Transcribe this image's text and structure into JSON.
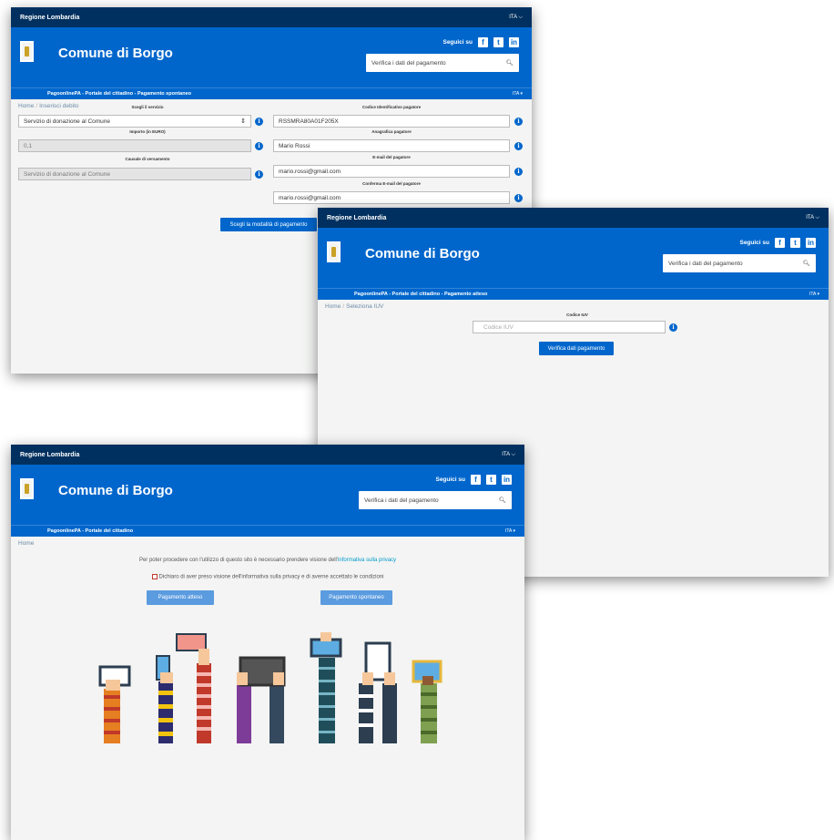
{
  "shared": {
    "region": "Regione Lombardia",
    "lang": "ITA",
    "comune": "Comune di Borgo",
    "follow": "Seguici su",
    "search_placeholder": "Verifica i dati del pagamento",
    "lang_small": "ITA",
    "home": "Home",
    "social": [
      "f",
      "t",
      "in"
    ]
  },
  "window1": {
    "nav": "PagoonlinePA - Portale del cittadino - Pagamento spontaneo",
    "crumb": "Inserisci debito",
    "service_label": "Scegli il servizio",
    "service_value": "Servizio di donazione al Comune",
    "amount_label": "Importo (in EURO)",
    "amount_value": "0,1",
    "causale_label": "Causale di versamento",
    "causale_value": "Servizio di donazione al Comune",
    "cf_label": "Codice Identificativo pagatore",
    "cf_value": "RSSMRA80A01F205X",
    "anag_label": "Anagrafica pagatore",
    "anag_value": "Mario Rossi",
    "email_label": "E-mail del pagatore",
    "email_value": "mario.rossi@gmail.com",
    "email_confirm_label": "Conferma E-mail del pagatore",
    "email_confirm_value": "mario.rossi@gmail.com",
    "submit": "Scegli la modalità di pagamento"
  },
  "window2": {
    "nav": "PagoonlinePA - Portale del cittadino - Pagamento atteso",
    "crumb": "Seleziona IUV",
    "iuv_label": "Codice IUV",
    "iuv_placeholder": "Codice IUV",
    "submit": "Verifica dati pagamento"
  },
  "window3": {
    "nav": "PagoonlinePA - Portale del cittadino",
    "privacy_text": "Per poter procedere con l'utilizzo di questo sito è necessario prendere visione dell'",
    "privacy_link": "informativa sulla privacy",
    "consent": "Dichiaro di aver preso visione dell'informativa sulla privacy e di averne accettato le condizioni",
    "btn_atteso": "Pagamento atteso",
    "btn_spontaneo": "Pagamento spontaneo"
  },
  "colors": {
    "topbar": "#00305f",
    "brand": "#0066cc",
    "link": "#0099cc"
  }
}
